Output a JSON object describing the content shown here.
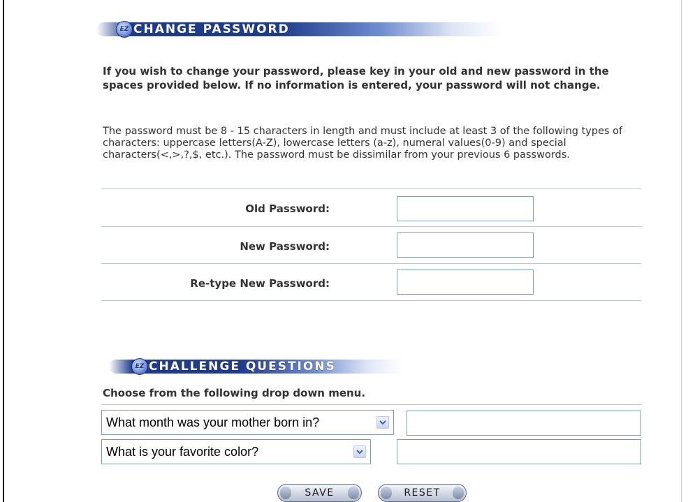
{
  "change_password": {
    "badge": "EZ",
    "title": "CHANGE PASSWORD",
    "intro": "If you wish to change your password, please key in your old and new password in the spaces provided below. If no information is entered, your password will not change.",
    "requirements": "The password must be 8 - 15 characters in length and must include at least 3 of the following types of characters: uppercase letters(A-Z), lowercase letters (a-z), numeral values(0-9) and special characters(<,>,?,$, etc.). The password must be dissimilar from your previous 6 passwords.",
    "fields": [
      {
        "label": "Old Password:",
        "value": ""
      },
      {
        "label": "New Password:",
        "value": ""
      },
      {
        "label": "Re-type New Password:",
        "value": ""
      }
    ]
  },
  "challenge_questions": {
    "badge": "EZ",
    "title": "CHALLENGE QUESTIONS",
    "instruction": "Choose from the following drop down menu.",
    "questions": [
      {
        "selected": "What month was your mother born in?",
        "answer": ""
      },
      {
        "selected": "What is your favorite color?",
        "answer": ""
      }
    ]
  },
  "buttons": {
    "save_label": "SAVE",
    "reset_label": "RESET"
  },
  "colors": {
    "banner_blue": "#1f3b8c",
    "input_border": "#7f9db9",
    "divider": "#b9c3d6",
    "text": "#333333"
  },
  "icons": {
    "section_badge": "ez-logo-icon",
    "dropdown": "chevron-down-icon"
  }
}
